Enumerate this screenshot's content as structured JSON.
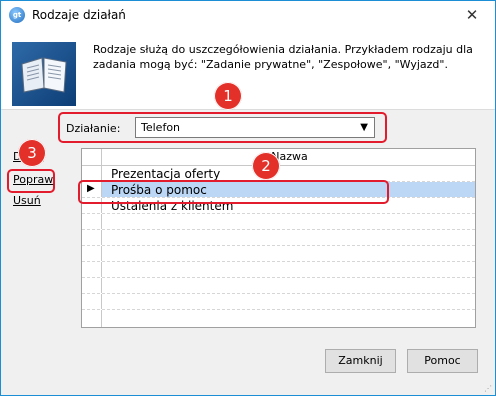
{
  "window": {
    "title": "Rodzaje działań",
    "close_glyph": "✕",
    "app_icon_text": "gt"
  },
  "header": {
    "description": "Rodzaje służą do uszczegółowienia działania. Przykładem rodzaju dla zadania mogą być: \"Zadanie prywatne\", \"Zespołowe\", \"Wyjazd\"."
  },
  "form": {
    "dzialanie_label": "Działanie:",
    "dzialanie_value": "Telefon",
    "dropdown_glyph": "▼"
  },
  "side_actions": {
    "dodaj": "Dodaj",
    "popraw": "Popraw",
    "usun": "Usuń"
  },
  "grid": {
    "column_header": "Nazwa",
    "rows": [
      "Prezentacja oferty",
      "Prośba o pomoc",
      "Ustalenia z klientem"
    ],
    "selected_index": 1,
    "row_pointer": "▶"
  },
  "badges": {
    "b1": "1",
    "b2": "2",
    "b3": "3"
  },
  "buttons": {
    "close": "Zamknij",
    "help": "Pomoc"
  },
  "colors": {
    "callout": "#e21c2c",
    "badge": "#e33029",
    "selection": "#bcd7f5",
    "window_border": "#1c8ed6"
  }
}
